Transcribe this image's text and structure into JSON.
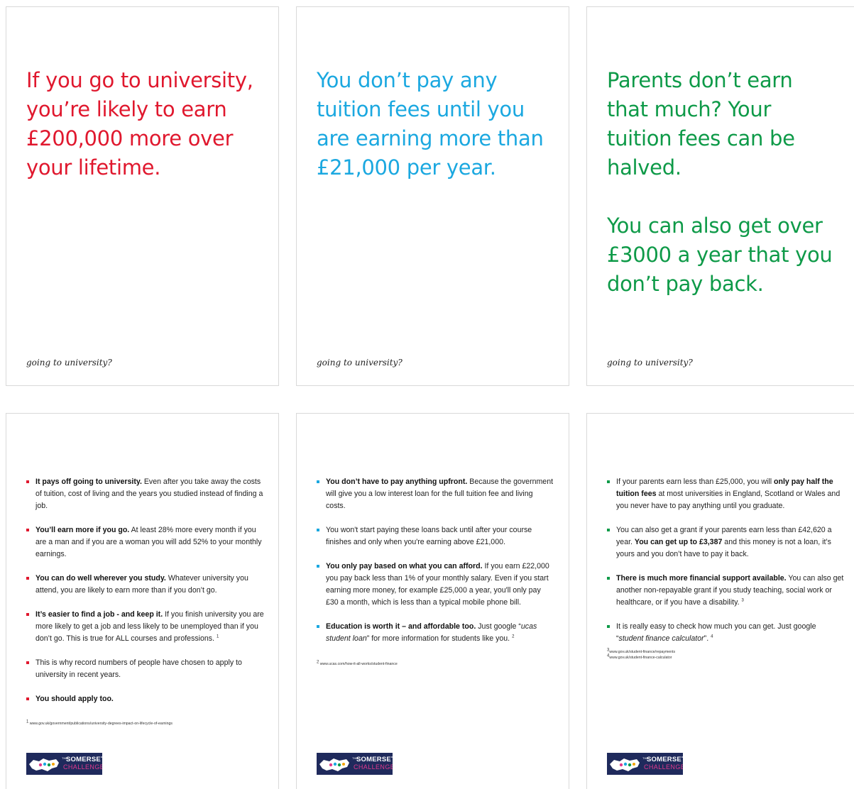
{
  "colors": {
    "red": "#e0182e",
    "blue": "#1ba8e0",
    "green": "#0e9a48",
    "logo_bg": "#1f2a5c",
    "logo_pink": "#e23a8c"
  },
  "tagline": "going to university?",
  "poster1": {
    "lines": [
      "If you go to university,",
      "you’re likely to earn",
      "£200,000 more over",
      "your lifetime."
    ]
  },
  "poster2": {
    "lines": [
      "You don’t pay any",
      "tuition fees until you",
      "are earning more than",
      "£21,000 per year."
    ]
  },
  "poster3": {
    "para1": [
      "Parents don’t earn",
      "that much? Your",
      "tuition fees can be",
      "halved."
    ],
    "para2": [
      "You can also get over",
      "£3000 a year that you",
      "don’t pay back."
    ]
  },
  "info1": {
    "b1_bold": "It pays off going to university.",
    "b1_text": " Even after you take away the costs of tuition, cost of living and the years you studied instead of finding a job.",
    "b2_bold": "You’ll earn more if you go.",
    "b2_text": " At least 28% more every month if you are a man and if you are a woman you will add 52% to your monthly earnings.",
    "b3_bold": "You can do well wherever you study.",
    "b3_text": " Whatever university you attend, you are likely to earn more than if you don’t go.",
    "b4_bold": "It’s easier to find a job - and keep it.",
    "b4_text": " If you finish university you are more likely to get a job and less likely to be unemployed than if you don’t go.  This is true for ALL courses and professions.",
    "b4_sup": "1",
    "b5_text": "This is why record numbers of people have chosen to apply to university in recent years.",
    "b6_bold": "You should apply too.",
    "note_sup": "1",
    "note": "www.gov.uk/government/publications/university-degrees-impact-on-lifecycle-of-earnings"
  },
  "info2": {
    "b1_bold": "You don’t have to pay anything upfront.",
    "b1_text": " Because the government will give you a low interest loan for the full tuition fee and living costs.",
    "b2_text": "You won't start paying these loans back until after your course finishes and only when you're earning above £21,000.",
    "b3_bold": "You only pay based on what you can afford.",
    "b3_text": " If you earn £22,000 you pay back less than 1% of your monthly salary. Even if you start earning more money, for example £25,000 a year, you'll only pay £30 a month, which is less than a typical mobile phone bill.",
    "b4_bold": "Education is worth it – and affordable too.",
    "b4_text1": " Just google “",
    "b4_italic": "ucas student loan",
    "b4_text2": "” for more information for students like you.",
    "b4_sup": "2",
    "note_sup": "2",
    "note": "www.ucas.com/how-it-all-works/student-finance"
  },
  "info3": {
    "b1_text1": "If your parents earn less than £25,000, you will ",
    "b1_bold": "only pay half the tuition fees",
    "b1_text2": " at most universities in England, Scotland or Wales and you never have to pay anything until you graduate.",
    "b2_text1": "You can also get a grant if your parents earn less than £42,620 a year. ",
    "b2_bold": "You can get up to £3,387",
    "b2_text2": " and this money is not a loan, it’s yours and you don’t have to pay it back.",
    "b3_bold": "There is much more financial support available.",
    "b3_text": " You can also get another non-repayable grant if you study teaching, social work or healthcare, or if you have a disability.",
    "b3_sup": "3",
    "b4_text1": "It is really easy to check how much you can get. Just google “",
    "b4_italic": "student finance calculator",
    "b4_text2": "”.",
    "b4_sup": "4",
    "note1_sup": "3",
    "note1": "www.gov.uk/student-finance/repayments",
    "note2_sup": "4",
    "note2": "www.gov.uk/student-finance-calculator"
  },
  "logo": {
    "the": "THE",
    "name": "SOMERSET",
    "sub": "CHALLENGE"
  }
}
